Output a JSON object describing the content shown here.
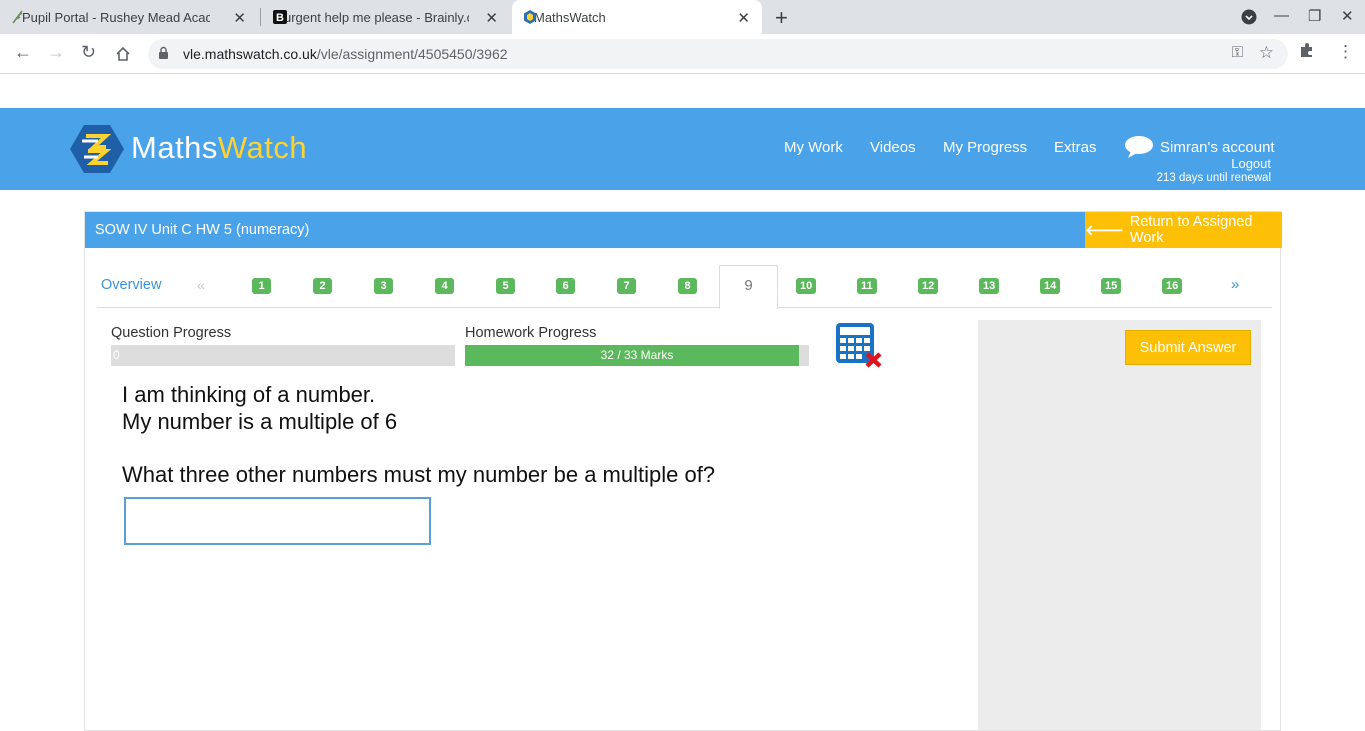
{
  "browser": {
    "tabs": [
      {
        "title": "Pupil Portal - Rushey Mead Acad",
        "favicon": "leaf-icon"
      },
      {
        "title": "urgent help me please - Brainly.co",
        "favicon": "brainly-icon"
      },
      {
        "title": "MathsWatch",
        "favicon": "mathswatch-icon",
        "active": true
      }
    ],
    "url_domain": "vle.mathswatch.co.uk",
    "url_path": "/vle/assignment/4505450/3962"
  },
  "header": {
    "logo_maths": "Maths",
    "logo_watch": "Watch",
    "nav": [
      "My Work",
      "Videos",
      "My Progress",
      "Extras"
    ],
    "account": "Simran's account",
    "logout": "Logout",
    "renewal": "213 days until renewal"
  },
  "assignment": {
    "title": "SOW IV Unit C HW 5 (numeracy)",
    "return_label": "Return to Assigned Work",
    "overview_label": "Overview",
    "prev_label": "«",
    "next_label": "»",
    "questions": [
      "1",
      "2",
      "3",
      "4",
      "5",
      "6",
      "7",
      "8",
      "9",
      "10",
      "11",
      "12",
      "13",
      "14",
      "15",
      "16"
    ],
    "current_question": "9"
  },
  "progress": {
    "question_label": "Question Progress",
    "question_value": "0",
    "question_fraction": 0,
    "homework_label": "Homework Progress",
    "homework_text": "32 / 33 Marks",
    "homework_fraction": 0.97
  },
  "question": {
    "line1": "I am thinking of a number.",
    "line2": "My number is a multiple of 6",
    "line3": "What three other numbers must my number be a multiple of?",
    "answer_value": ""
  },
  "submit_label": "Submit Answer",
  "colors": {
    "brand_blue": "#4aa3e9",
    "accent_yellow": "#fdc006",
    "success_green": "#5cb85c"
  }
}
